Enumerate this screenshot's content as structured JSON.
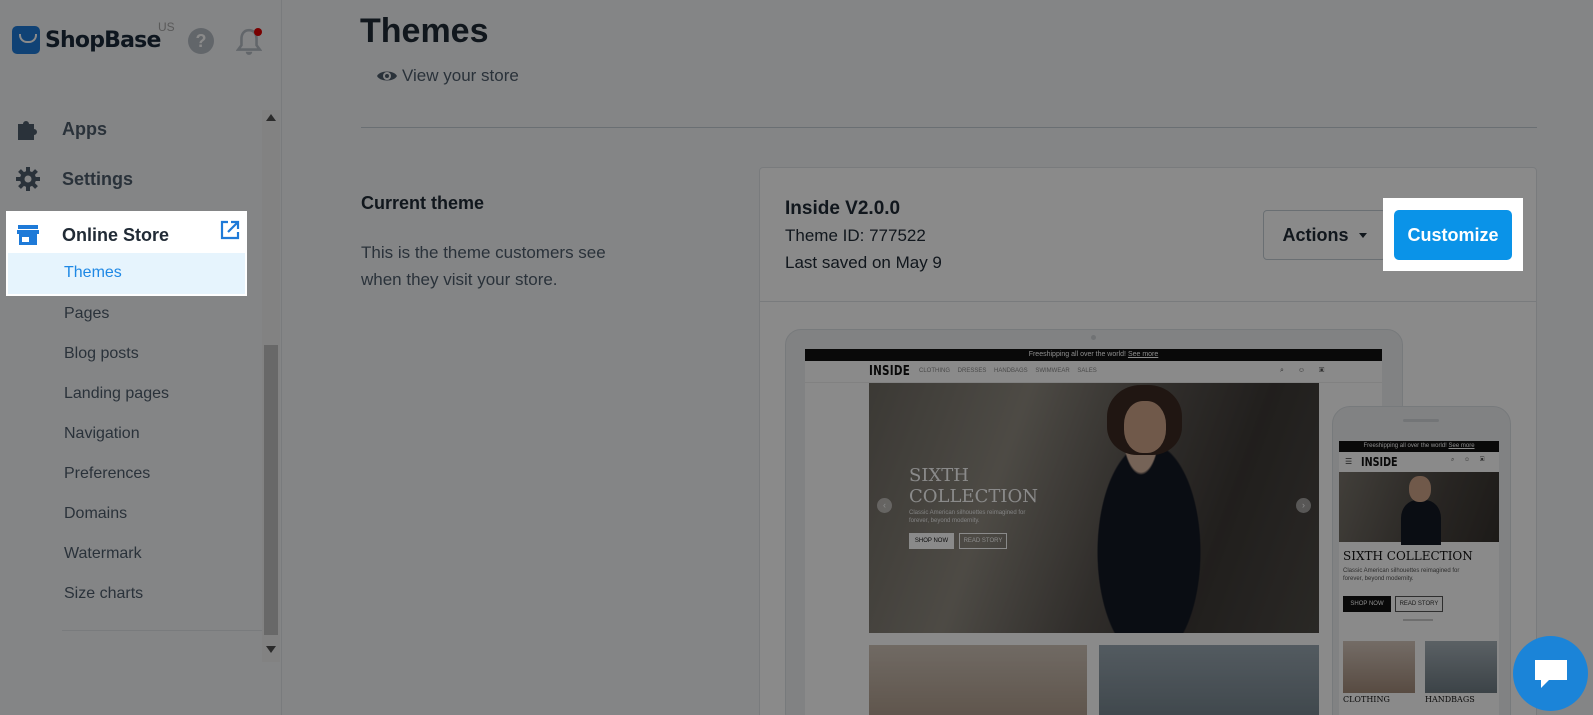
{
  "brand": {
    "name": "ShopBase",
    "region": "US"
  },
  "sidebar": {
    "items": [
      {
        "label": "Apps",
        "icon": "puzzle-icon"
      },
      {
        "label": "Settings",
        "icon": "gear-icon"
      }
    ],
    "online_store": {
      "label": "Online Store",
      "icon": "store-icon",
      "external_icon": "external-link-icon",
      "subitems": [
        "Themes",
        "Pages",
        "Blog posts",
        "Landing pages",
        "Navigation",
        "Preferences",
        "Domains",
        "Watermark",
        "Size charts"
      ],
      "active": "Themes"
    }
  },
  "header": {
    "title": "Themes",
    "view_store": "View your store"
  },
  "current_theme": {
    "section_title": "Current theme",
    "section_desc": "This is the theme customers see when they visit your store.",
    "name": "Inside V2.0.0",
    "theme_id_label": "Theme ID:",
    "theme_id": "777522",
    "last_saved": "Last saved on May 9",
    "actions_label": "Actions",
    "customize_label": "Customize"
  },
  "preview": {
    "announcement": "Freeshipping all over the world!",
    "announcement_link": "See more",
    "site_brand": "INSIDE",
    "site_links": "CLOTHING DRESSES HANDBAGS SWIMWEAR SALES",
    "hero_title_line1": "SIXTH",
    "hero_title_line2": "COLLECTION",
    "hero_title_mobile": "SIXTH COLLECTION",
    "hero_text": "Classic American silhouettes reimagined for forever, beyond modernity.",
    "shop_now": "SHOP NOW",
    "read_story": "READ STORY",
    "category_1": "CLOTHING",
    "category_2": "HANDBAGS"
  },
  "colors": {
    "accent": "#0a93e8",
    "active_nav_bg": "#e6f4fd",
    "active_nav_text": "#1e88e5",
    "notification_dot": "#e00000",
    "chat": "#1b84d8"
  }
}
